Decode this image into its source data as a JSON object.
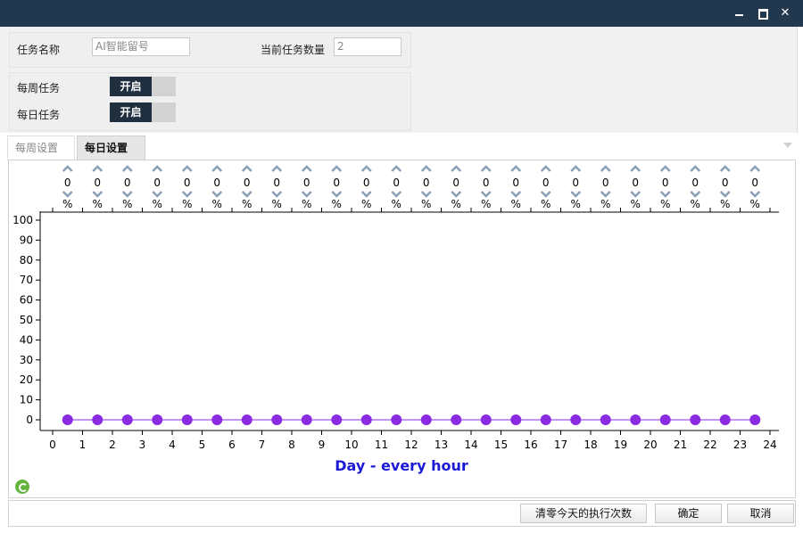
{
  "settings": {
    "task_name_label": "任务名称",
    "task_name_value": "AI智能留号",
    "current_count_label": "当前任务数量",
    "current_count_value": "2",
    "weekly_task_label": "每周任务",
    "weekly_toggle": "开启",
    "daily_task_label": "每日任务",
    "daily_toggle": "开启"
  },
  "tabs": [
    "每周设置",
    "每日设置"
  ],
  "active_tab": "每日设置",
  "chart_data": {
    "type": "line",
    "title": "",
    "xlabel": "Day - every hour",
    "ylabel": "",
    "x": [
      0.5,
      1.5,
      2.5,
      3.5,
      4.5,
      5.5,
      6.5,
      7.5,
      8.5,
      9.5,
      10.5,
      11.5,
      12.5,
      13.5,
      14.5,
      15.5,
      16.5,
      17.5,
      18.5,
      19.5,
      20.5,
      21.5,
      22.5,
      23.5
    ],
    "values": [
      0,
      0,
      0,
      0,
      0,
      0,
      0,
      0,
      0,
      0,
      0,
      0,
      0,
      0,
      0,
      0,
      0,
      0,
      0,
      0,
      0,
      0,
      0,
      0
    ],
    "xlim": [
      0,
      24
    ],
    "ylim": [
      0,
      100
    ],
    "xticks": [
      0,
      1,
      2,
      3,
      4,
      5,
      6,
      7,
      8,
      9,
      10,
      11,
      12,
      13,
      14,
      15,
      16,
      17,
      18,
      19,
      20,
      21,
      22,
      23,
      24
    ],
    "yticks": [
      0,
      10,
      20,
      30,
      40,
      50,
      60,
      70,
      80,
      90,
      100
    ],
    "control_unit": "%",
    "point_color": "#8a2be2",
    "xlabel_color": "#1a1ad6"
  },
  "footer": {
    "clear_button": "清零今天的执行次数",
    "ok_button": "确定",
    "cancel_button": "取消"
  }
}
